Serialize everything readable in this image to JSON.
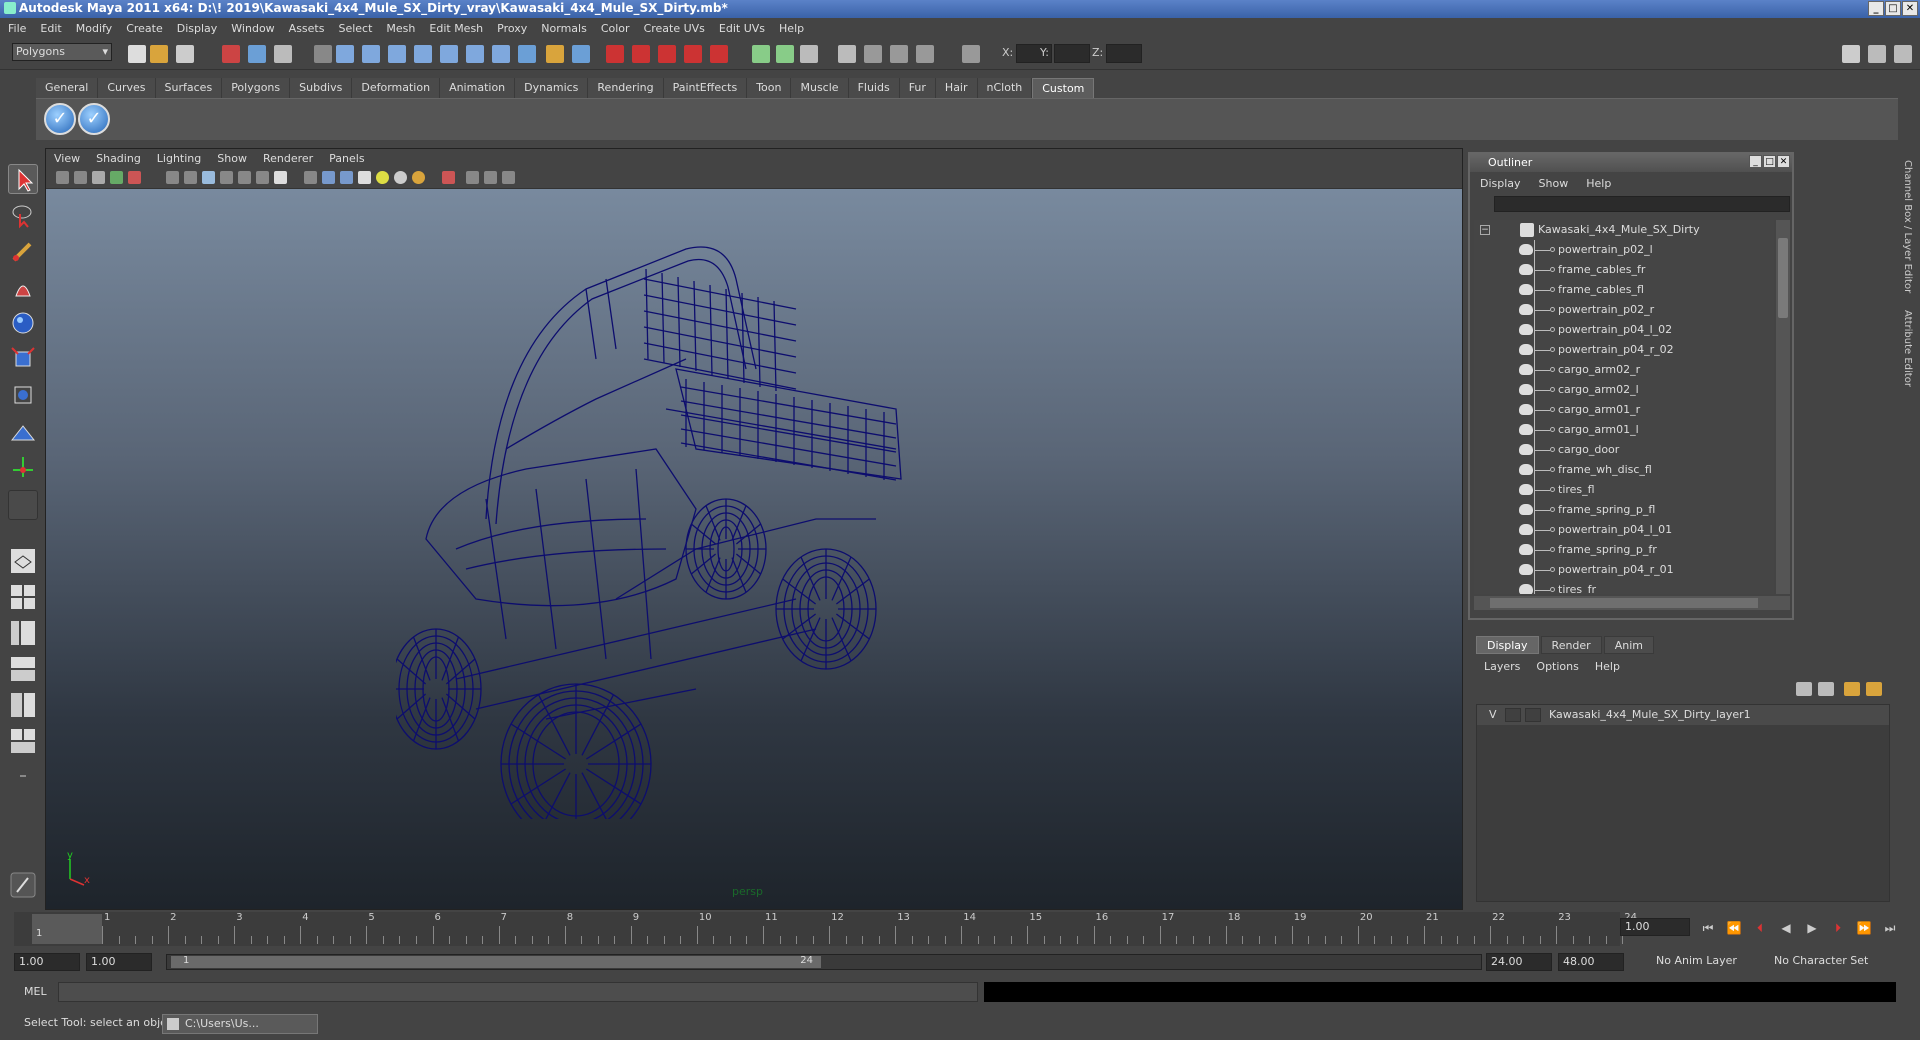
{
  "window": {
    "title": "Autodesk Maya 2011 x64: D:\\! 2019\\Kawasaki_4x4_Mule_SX_Dirty_vray\\Kawasaki_4x4_Mule_SX_Dirty.mb*"
  },
  "menubar": [
    "File",
    "Edit",
    "Modify",
    "Create",
    "Display",
    "Window",
    "Assets",
    "Select",
    "Mesh",
    "Edit Mesh",
    "Proxy",
    "Normals",
    "Color",
    "Create UVs",
    "Edit UVs",
    "Help"
  ],
  "statusline": {
    "mode": "Polygons",
    "x_label": "X:",
    "y_label": "Y:",
    "z_label": "Z:"
  },
  "shelf": {
    "tabs": [
      "General",
      "Curves",
      "Surfaces",
      "Polygons",
      "Subdivs",
      "Deformation",
      "Animation",
      "Dynamics",
      "Rendering",
      "PaintEffects",
      "Toon",
      "Muscle",
      "Fluids",
      "Fur",
      "Hair",
      "nCloth",
      "Custom"
    ],
    "active_tab": "Custom"
  },
  "viewport": {
    "menu": [
      "View",
      "Shading",
      "Lighting",
      "Show",
      "Renderer",
      "Panels"
    ],
    "camera_label": "persp",
    "axis_x": "x",
    "axis_y": "y",
    "wire_color": "#0d0d6e"
  },
  "outliner": {
    "title": "Outliner",
    "menu": [
      "Display",
      "Show",
      "Help"
    ],
    "root": "Kawasaki_4x4_Mule_SX_Dirty",
    "items": [
      "powertrain_p02_l",
      "frame_cables_fr",
      "frame_cables_fl",
      "powertrain_p02_r",
      "powertrain_p04_l_02",
      "powertrain_p04_r_02",
      "cargo_arm02_r",
      "cargo_arm02_l",
      "cargo_arm01_r",
      "cargo_arm01_l",
      "cargo_door",
      "frame_wh_disc_fl",
      "tires_fl",
      "frame_spring_p_fl",
      "powertrain_p04_l_01",
      "frame_spring_p_fr",
      "powertrain_p04_r_01",
      "tires_fr"
    ]
  },
  "layer_editor": {
    "tabs": [
      "Display",
      "Render",
      "Anim"
    ],
    "active_tab": "Display",
    "menu": [
      "Layers",
      "Options",
      "Help"
    ],
    "layer": {
      "visible": "V",
      "name": "Kawasaki_4x4_Mule_SX_Dirty_layer1"
    }
  },
  "side_tabs": [
    "Channel Box / Layer Editor",
    "Attribute Editor"
  ],
  "timeslider": {
    "ticks": [
      "1",
      "2",
      "3",
      "4",
      "5",
      "6",
      "7",
      "8",
      "9",
      "10",
      "11",
      "12",
      "13",
      "14",
      "15",
      "16",
      "17",
      "18",
      "19",
      "20",
      "21",
      "22",
      "23",
      "24"
    ],
    "current_marker": "1",
    "current_frame": "1.00"
  },
  "range": {
    "start": "1.00",
    "playback_start": "1.00",
    "handle_start": "1",
    "handle_end": "24",
    "playback_end": "24.00",
    "end": "48.00",
    "anim_layer": "No Anim Layer",
    "character_set": "No Character Set"
  },
  "cmdline": {
    "label": "MEL"
  },
  "helpline": {
    "text": "Select Tool: select an object",
    "task": "C:\\Users\\Us..."
  }
}
